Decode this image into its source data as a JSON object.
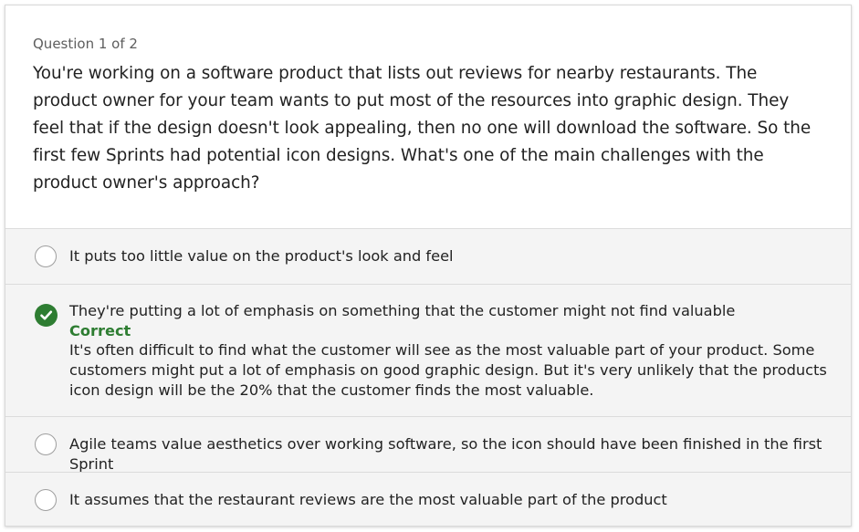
{
  "question": {
    "counter": "Question 1 of 2",
    "text": "You're working on a software product that lists out reviews for nearby restaurants. The product owner for your team wants to put most of the resources into graphic design. They feel that if the design doesn't look appealing, then no one will download the software. So the first few Sprints had potential icon designs. What's one of the main challenges with the product owner's approach?"
  },
  "options": [
    {
      "label": "It puts too little value on the product's look and feel",
      "state": "unselected"
    },
    {
      "label": "They're putting a lot of emphasis on something that the customer might not find valuable",
      "state": "correct",
      "feedback_status": "Correct",
      "feedback_text": "It's often difficult to find what the customer will see as the most valuable part of your product. Some customers might put a lot of emphasis on good graphic design. But it's very unlikely that the products icon design will be the 20% that the customer finds the most valuable."
    },
    {
      "label": "Agile teams value aesthetics over working software, so the icon should have been finished in the first Sprint",
      "state": "unselected"
    },
    {
      "label": "It assumes that the restaurant reviews are the most valuable part of the product",
      "state": "unselected"
    }
  ],
  "colors": {
    "correct": "#2e7d32",
    "options_background": "#f4f4f4",
    "divider": "#dcdcdc"
  },
  "icons": {
    "correct": "checkmark-circle-icon",
    "unselected": "radio-empty-icon"
  }
}
